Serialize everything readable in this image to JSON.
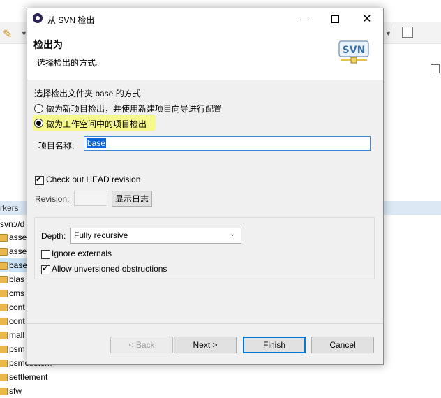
{
  "background": {
    "panel_label": "rkers",
    "tree_root": "svn://d",
    "tree_items": [
      "asse",
      "asse",
      "base",
      "blas",
      "cms",
      "cont",
      "cont",
      "mall",
      "psm",
      "psmcustom",
      "settlement",
      "sfw"
    ]
  },
  "dialog": {
    "title": "从 SVN 检出",
    "header_title": "检出为",
    "header_desc": "选择检出的方式。",
    "logo_text": "SVN",
    "section_label": "选择检出文件夹 base 的方式",
    "option_new_project": "做为新项目检出，并使用新建项目向导进行配置",
    "option_workspace": "做为工作空间中的项目检出",
    "project_name_label": "项目名称:",
    "project_name_value": "base",
    "head_revision_label": "Check out HEAD revision",
    "revision_label": "Revision:",
    "show_log_label": "显示日志",
    "depth_label": "Depth:",
    "depth_value": "Fully recursive",
    "ignore_externals_label": "Ignore externals",
    "allow_unversioned_label": "Allow unversioned obstructions",
    "back_label": "< Back",
    "next_label": "Next >",
    "finish_label": "Finish",
    "cancel_label": "Cancel",
    "selected_option": "option_workspace",
    "head_revision_checked": true,
    "ignore_externals_checked": false,
    "allow_unversioned_checked": true
  }
}
